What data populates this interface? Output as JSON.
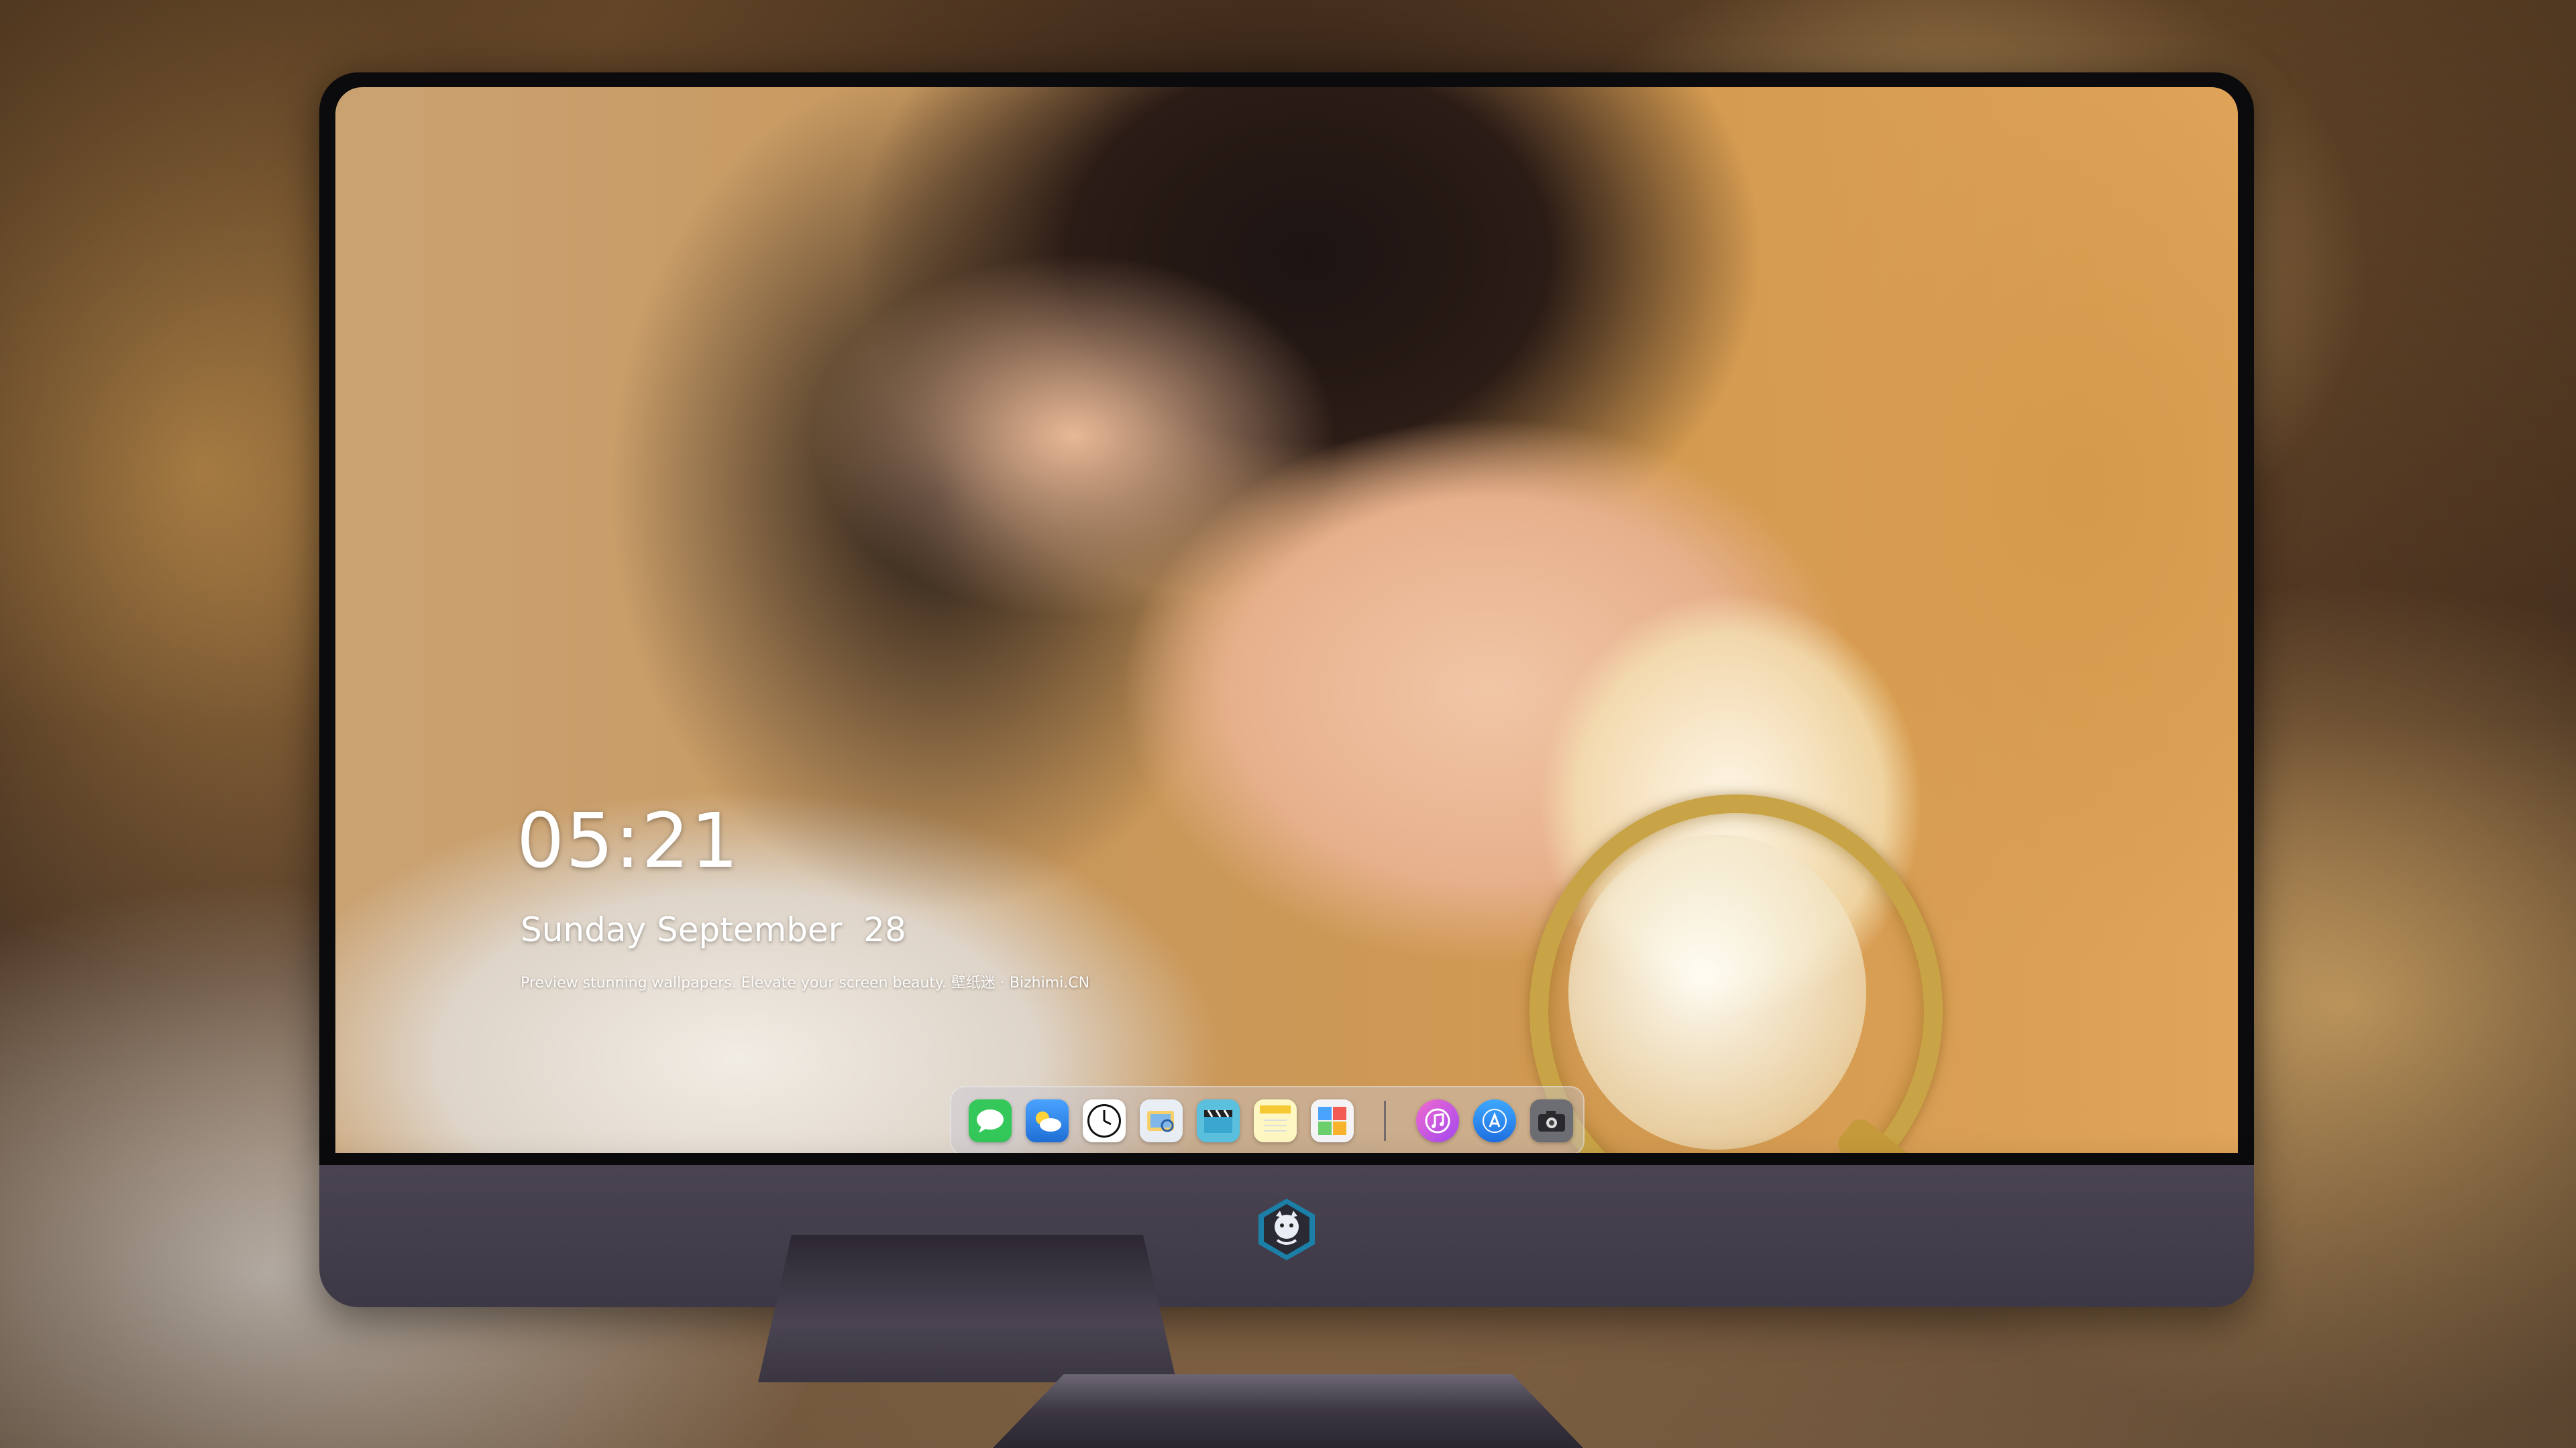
{
  "lockscreen": {
    "time": "05:21",
    "date": "Sunday September  28",
    "tagline": "Preview stunning wallpapers. Elevate your screen beauty. 壁纸迷 · Bizhimi.CN"
  },
  "dock": {
    "apps": [
      {
        "name": "messages-icon",
        "glyph": "💬",
        "bg": "#34c759"
      },
      {
        "name": "weather-icon",
        "glyph": "⛅",
        "bg": "#3a8ee6"
      },
      {
        "name": "clock-icon",
        "glyph": "🕔",
        "bg": "#ffffff"
      },
      {
        "name": "preview-icon",
        "glyph": "🖼",
        "bg": "#e9edf4"
      },
      {
        "name": "claquette-icon",
        "glyph": "🎬",
        "bg": "#5bc0de"
      },
      {
        "name": "notes-icon",
        "glyph": "📝",
        "bg": "#fff7c2"
      },
      {
        "name": "photo-booth-icon",
        "glyph": "🖼",
        "bg": "#f4f4f6"
      }
    ],
    "utilities": [
      {
        "name": "itunes-icon",
        "glyph": "♫",
        "bg": "#e75ad6"
      },
      {
        "name": "app-store-icon",
        "glyph": "A",
        "bg": "#2f8cf5"
      },
      {
        "name": "camera-icon",
        "glyph": "📷",
        "bg": "#6d6d74"
      }
    ]
  },
  "colors": {
    "bezel": "#0b0b0d",
    "chin": "#4a4452",
    "text": "#ffffff"
  }
}
